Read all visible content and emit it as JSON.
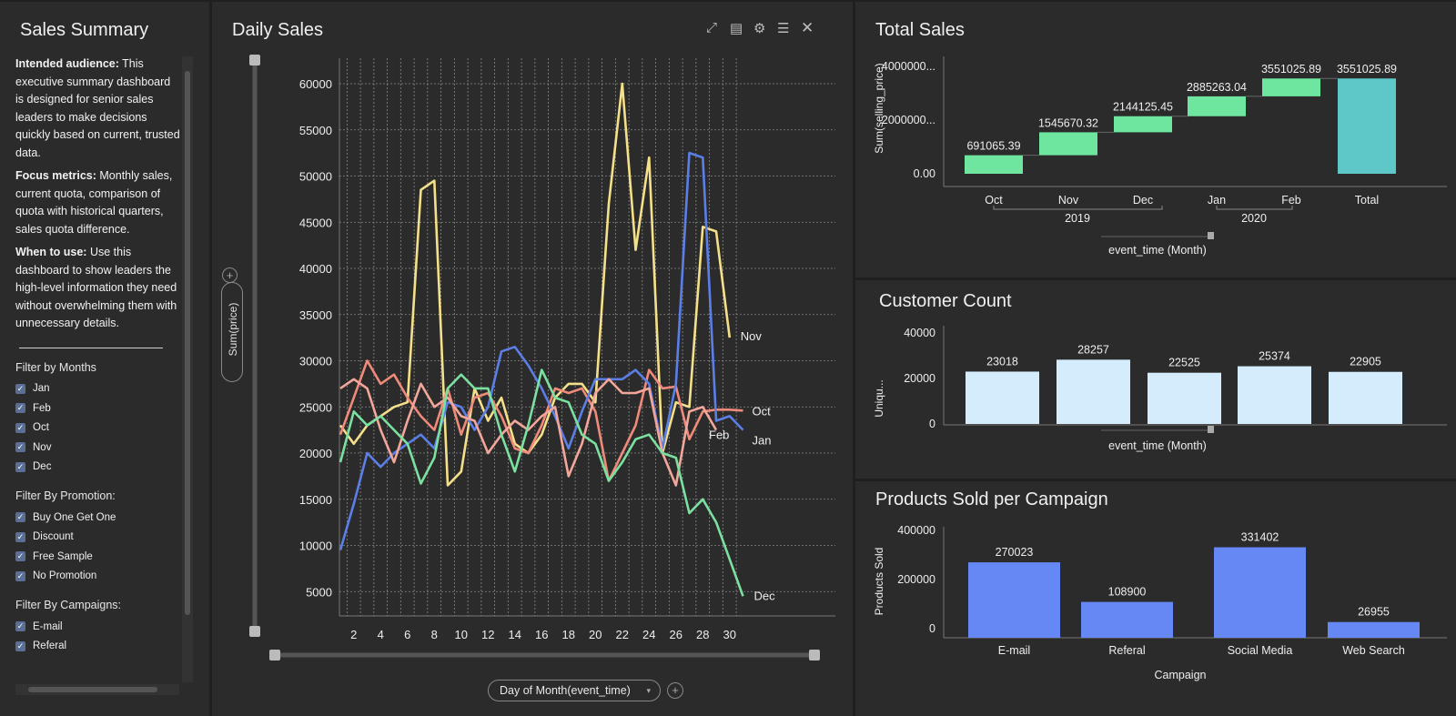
{
  "left": {
    "title": "Sales Summary",
    "para1_bold": "Intended audience:",
    "para1_text": " This executive summary dashboard is designed for senior sales leaders to make decisions quickly based on current, trusted data.",
    "para2_bold": "Focus metrics:",
    "para2_text": " Monthly sales, current quota, comparison of quota with historical quarters, sales quota difference.",
    "para3_bold": "When to use:",
    "para3_text": " Use this dashboard to show leaders the high-level information they need without overwhelming them with unnecessary details.",
    "filter_months_label": "Filter by Months",
    "months": [
      "Jan",
      "Feb",
      "Oct",
      "Nov",
      "Dec"
    ],
    "filter_promo_label": "Filter By Promotion:",
    "promotions": [
      "Buy One Get One",
      "Discount",
      "Free Sample",
      "No Promotion"
    ],
    "filter_campaign_label": "Filter By Campaigns:",
    "campaigns": [
      "E-mail",
      "Referal"
    ]
  },
  "daily": {
    "title": "Daily Sales",
    "y_axis_pill": "Sum(price)",
    "x_axis_pill": "Day of Month(event_time)",
    "icons": [
      "expand-icon",
      "export-icon",
      "gear-icon",
      "list-icon",
      "close-icon"
    ]
  },
  "total": {
    "title": "Total Sales",
    "ylabel": "Sum(selling_price)",
    "xlabel": "event_time (Month)",
    "years": [
      "2019",
      "2020"
    ]
  },
  "customer": {
    "title": "Customer Count",
    "ylabel": "Uniqu...",
    "xlabel": "event_time (Month)"
  },
  "products": {
    "title": "Products Sold per Campaign",
    "ylabel": "Products Sold",
    "xlabel": "Campaign"
  },
  "colors": {
    "nov": "#f5e08a",
    "jan": "#5b7fe6",
    "oct": "#f08a7a",
    "feb": "#f2a79a",
    "dec": "#7be0a0",
    "waterfall": "#6ee6a0",
    "total": "#5ec8c8",
    "customer_bar": "#d4ecfc",
    "campaign_bar": "#6688f5"
  },
  "chart_data": [
    {
      "type": "line",
      "x": [
        1,
        2,
        3,
        4,
        5,
        6,
        7,
        8,
        9,
        10,
        11,
        12,
        13,
        14,
        15,
        16,
        17,
        18,
        19,
        20,
        21,
        22,
        23,
        24,
        25,
        26,
        27,
        28,
        29,
        30,
        31
      ],
      "xticks": [
        2,
        4,
        6,
        8,
        10,
        12,
        14,
        16,
        18,
        20,
        22,
        24,
        26,
        28,
        30
      ],
      "yticks": [
        5000,
        10000,
        15000,
        20000,
        25000,
        30000,
        35000,
        40000,
        45000,
        50000,
        55000,
        60000
      ],
      "ylim": [
        0,
        62500
      ],
      "series": [
        {
          "name": "Nov",
          "values": [
            23000,
            21000,
            23000,
            24000,
            25000,
            25500,
            48500,
            49500,
            16500,
            18000,
            27000,
            23500,
            26000,
            21000,
            20000,
            22000,
            26000,
            27500,
            27500,
            25500,
            47000,
            60000,
            42000,
            52000,
            20000,
            25500,
            25000,
            44500,
            44000,
            32500,
            null
          ]
        },
        {
          "name": "Oct",
          "values": [
            22000,
            26000,
            30000,
            27500,
            28500,
            26000,
            24000,
            22500,
            27000,
            22000,
            26000,
            26500,
            24000,
            20500,
            20000,
            23000,
            27000,
            26500,
            27000,
            24500,
            17000,
            20000,
            23000,
            29000,
            27000,
            27200,
            21500,
            24500,
            24700,
            24700,
            24600
          ]
        },
        {
          "name": "Jan",
          "values": [
            9500,
            14500,
            20000,
            18500,
            20000,
            21000,
            22000,
            20500,
            25500,
            25000,
            22500,
            25000,
            31000,
            31500,
            29500,
            27000,
            24000,
            20500,
            24500,
            28000,
            28000,
            28000,
            29000,
            27500,
            20500,
            27500,
            52500,
            52000,
            23500,
            24000,
            22500
          ]
        },
        {
          "name": "Feb",
          "values": [
            27000,
            28000,
            27000,
            22500,
            19000,
            23500,
            27500,
            25000,
            26000,
            24000,
            23500,
            20000,
            22000,
            23500,
            22500,
            24000,
            25000,
            17500,
            21000,
            26500,
            28000,
            26500,
            26500,
            27000,
            20000,
            16500,
            24500,
            25000,
            22500,
            null,
            null
          ]
        },
        {
          "name": "Dec",
          "values": [
            19000,
            24500,
            23000,
            24000,
            22500,
            21000,
            16700,
            19500,
            27000,
            28500,
            27000,
            27000,
            22000,
            18000,
            23000,
            29000,
            26000,
            25500,
            22000,
            21000,
            17000,
            19000,
            21500,
            22000,
            20000,
            19500,
            13500,
            15000,
            12500,
            8500,
            4500
          ]
        }
      ]
    },
    {
      "type": "bar",
      "title": "Total Sales",
      "categories": [
        "Oct",
        "Nov",
        "Dec",
        "Jan",
        "Feb",
        "Total"
      ],
      "values": [
        691065.39,
        1545670.32,
        2144125.45,
        2885263.04,
        3551025.89,
        3551025.89
      ],
      "value_labels": [
        "691065.39",
        "1545670.32",
        "2144125.45",
        "2885263.04",
        "3551025.89",
        "3551025.89"
      ],
      "yticks": [
        "0.00",
        "2000000...",
        "4000000..."
      ],
      "ytick_values": [
        0,
        2000000,
        4000000
      ],
      "ylim": [
        0,
        4500000
      ]
    },
    {
      "type": "bar",
      "title": "Customer Count",
      "categories": [
        "Oct",
        "Nov",
        "Dec",
        "Jan",
        "Feb"
      ],
      "values": [
        23018,
        28257,
        22525,
        25374,
        22905
      ],
      "yticks": [
        0,
        20000,
        40000
      ],
      "ylim": [
        0,
        40000
      ]
    },
    {
      "type": "bar",
      "title": "Products Sold per Campaign",
      "categories": [
        "E-mail",
        "Referal",
        "Social Media",
        "Web Search"
      ],
      "values": [
        270023,
        108900,
        331402,
        26955
      ],
      "yticks": [
        0,
        200000,
        400000
      ],
      "ylim": [
        0,
        400000
      ]
    }
  ]
}
